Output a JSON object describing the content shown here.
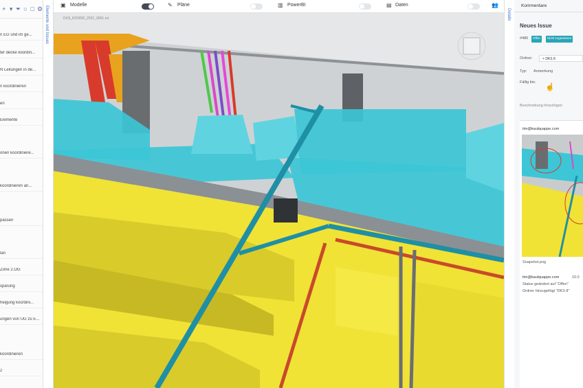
{
  "sidebar": {
    "toolbar_icons": [
      "add-icon",
      "plus-icon",
      "filter-icon",
      "circle-icon",
      "square-icon",
      "settings-icon"
    ],
    "items": [
      "n EG und im ge...",
      "ter decke koordin...",
      "N Leitungen in de...",
      "n koordinieren",
      "en",
      "Elemente",
      "onen koordiniere...",
      "koordinieren an...",
      "passen",
      "lan",
      "Zone 2.OG",
      "sparung",
      "heigung koordini...",
      "ungen von UG zu E...",
      "koordinieren",
      "2"
    ]
  },
  "left_tab": "Elemente und Issues",
  "right_tab": "Details",
  "topbar": {
    "modelle": "Modelle",
    "plaene": "Pläne",
    "powerbi": "PowerBI",
    "daten": "Daten",
    "toggles": [
      true,
      false,
      false,
      false
    ]
  },
  "viewport": {
    "file_label": "DXS_KOORD_2021_0001.rvt"
  },
  "issue": {
    "panel_title": "Kommentare",
    "title": "Neues Issue",
    "number": "#486",
    "badge_status": "Offen",
    "badge_assign": "Nicht zugewiesen",
    "folder_label": "Ordner:",
    "folder_value": "DKS 8",
    "type_label": "Typ:",
    "type_value": "Anmerkung",
    "due_label": "Fällig bis:",
    "description_placeholder": "Beschreibung hinzufügen"
  },
  "comment": {
    "author": "tim@kaulquappe.com",
    "attachment": "Snapshot.png",
    "activity_author": "tim@kaulquappe.com",
    "activity_time": "10.0",
    "activity_1": "Status geändert auf \"Offen\"",
    "activity_2": "Ordner hinzugefügt \"DKS 8\""
  },
  "colors": {
    "cyan_duct": "#3cc6d6",
    "yellow_tray": "#f1e236",
    "teal_pipe": "#1f8fa5",
    "red_pipe": "#c84a2a",
    "orange": "#e8a21e",
    "accent": "#3c6fd0"
  }
}
